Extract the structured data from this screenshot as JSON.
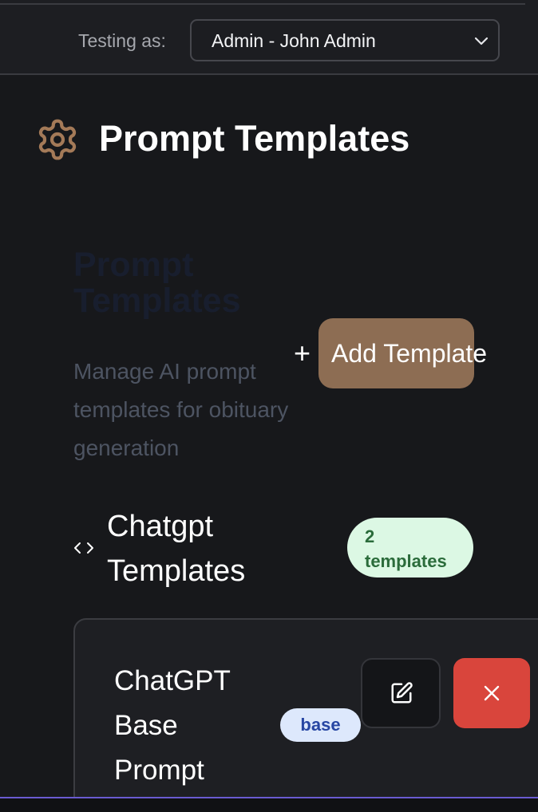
{
  "header": {
    "testing_label": "Testing as:",
    "role_select": {
      "value": "Admin - John Admin"
    }
  },
  "page": {
    "title": "Prompt Templates",
    "icon": "gear-icon",
    "accent_color": "#8d6d53"
  },
  "section": {
    "title": "Prompt Templates",
    "description": "Manage AI prompt templates for obituary generation",
    "add_button_label": "Add Template",
    "add_button_icon": "plus-icon",
    "add_button_plus": "+"
  },
  "groups": [
    {
      "icon": "code-icon",
      "title": "Chatgpt Templates",
      "count_badge": "2 templates",
      "badge_color": "#dcf8e4",
      "templates": [
        {
          "name": "ChatGPT Base Prompt",
          "type_badge": "base",
          "type_badge_color": "#dde8fc",
          "edit_icon": "edit-icon",
          "delete_icon": "close-icon",
          "delete_color": "#d9453c"
        }
      ]
    }
  ]
}
